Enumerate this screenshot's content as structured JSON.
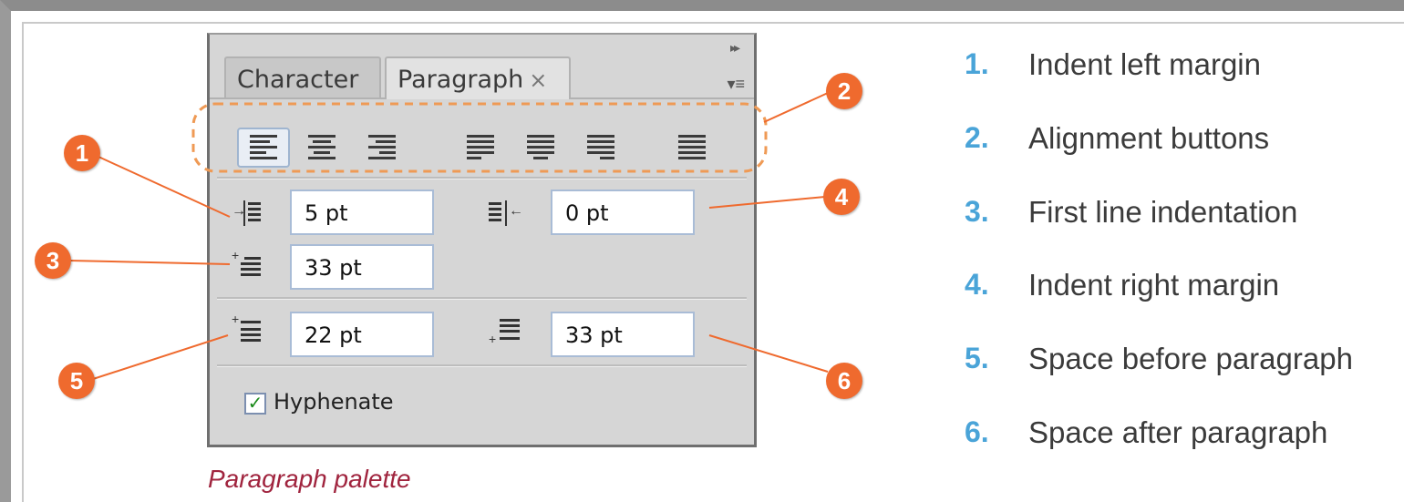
{
  "palette": {
    "tabs": [
      {
        "label": "Character"
      },
      {
        "label": "Paragraph",
        "close": "×"
      }
    ],
    "collapse_glyph": "▸▸",
    "menu_glyph": "▾≡",
    "alignment_buttons": [
      {
        "name": "align-left",
        "selected": true
      },
      {
        "name": "align-center",
        "selected": false
      },
      {
        "name": "align-right",
        "selected": false
      },
      {
        "name": "justify-last-left",
        "selected": false
      },
      {
        "name": "justify-last-center",
        "selected": false
      },
      {
        "name": "justify-last-right",
        "selected": false
      },
      {
        "name": "justify-all",
        "selected": false
      }
    ],
    "fields": {
      "indent_left": "5 pt",
      "indent_right": "0 pt",
      "first_line_indent": "33 pt",
      "space_before": "22 pt",
      "space_after": "33 pt"
    },
    "hyphenate": {
      "label": "Hyphenate",
      "checked": true
    }
  },
  "caption": "Paragraph palette",
  "markers": [
    "1",
    "2",
    "3",
    "4",
    "5",
    "6"
  ],
  "legend": [
    {
      "num": "1.",
      "text": "Indent left margin"
    },
    {
      "num": "2.",
      "text": "Alignment buttons"
    },
    {
      "num": "3.",
      "text": "First line indentation"
    },
    {
      "num": "4.",
      "text": "Indent right margin"
    },
    {
      "num": "5.",
      "text": "Space before paragraph"
    },
    {
      "num": "6.",
      "text": "Space after paragraph"
    }
  ],
  "colors": {
    "marker": "#ef6a2e",
    "legend_number": "#4aa4d8",
    "caption": "#a0243e",
    "callout_line": "#ef6a2e"
  }
}
